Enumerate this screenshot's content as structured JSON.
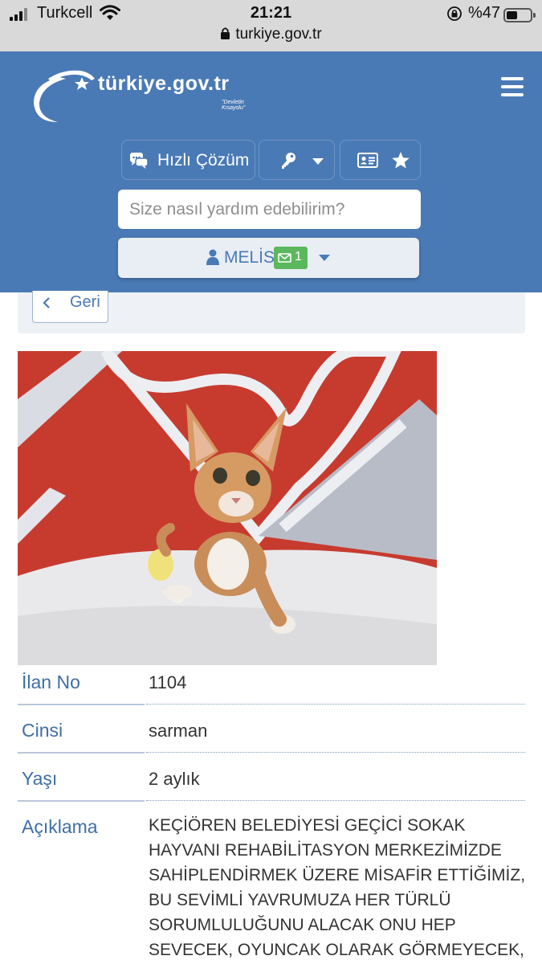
{
  "status_bar": {
    "carrier": "Turkcell",
    "time": "21:21",
    "battery": "%47",
    "battery_level": 0.47,
    "url": "turkiye.gov.tr"
  },
  "header": {
    "logo_text": "türkiye.gov.tr",
    "logo_tagline": "\"Devletin Kısayolu\"",
    "quick_solution_label": "Hızlı Çözüm",
    "search_placeholder": "Size nasıl yardım edebilirim?",
    "user_name": "MELİS",
    "message_count": "1",
    "colors": {
      "header_bg": "#4a7ab5",
      "badge_green": "#5cb85c"
    }
  },
  "back": {
    "label": "Geri"
  },
  "listing": {
    "rows": [
      {
        "label": "İlan No",
        "value": "1104"
      },
      {
        "label": "Cinsi",
        "value": "sarman"
      },
      {
        "label": "Yaşı",
        "value": "2 aylık"
      },
      {
        "label": "Açıklama",
        "value": "KEÇİÖREN BELEDİYESİ GEÇİCİ SOKAK HAYVANI REHABİLİTASYON MERKEZİMİZDE SAHİPLENDİRMEK ÜZERE MİSAFİR ETTİĞİMİZ, BU SEVİMLİ YAVRUMUZA HER TÜRLÜ SORUMLULUĞUNU ALACAK ONU HEP SEVECEK, OYUNCAK OLARAK GÖRMEYECEK,"
      }
    ]
  },
  "icons": [
    "signal-icon",
    "wifi-icon",
    "lock-icon",
    "orientation-lock-icon",
    "battery-icon",
    "logo-crescent-icon",
    "menu-icon",
    "chat-bubbles-icon",
    "key-icon",
    "chevron-down-icon",
    "id-card-icon",
    "star-icon",
    "search-icon",
    "user-icon",
    "envelope-icon",
    "chevron-left-icon"
  ]
}
